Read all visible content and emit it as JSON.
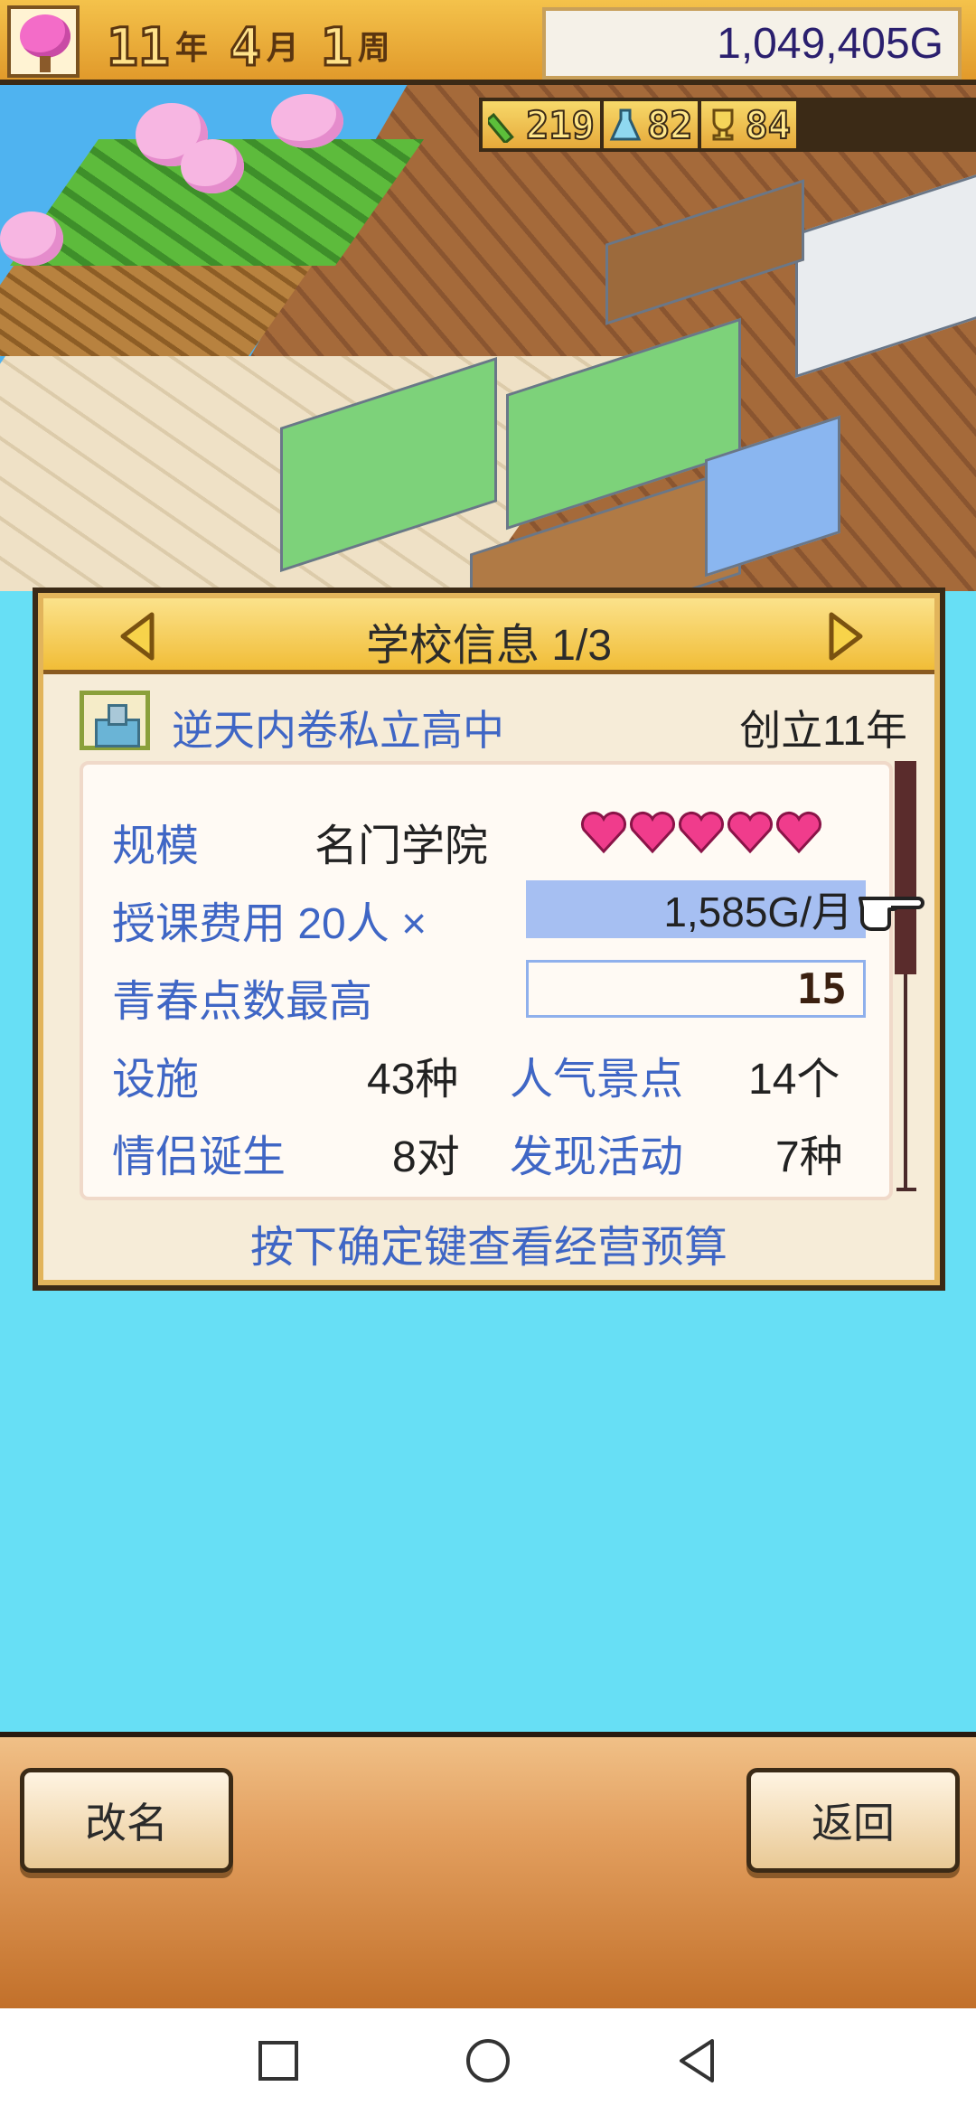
{
  "top": {
    "year": "11",
    "year_unit": "年",
    "month": "4",
    "month_unit": "月",
    "week": "1",
    "week_unit": "周",
    "money": "1,049,405G"
  },
  "stats": [
    {
      "icon": "pencil-icon",
      "value": "219"
    },
    {
      "icon": "flask-icon",
      "value": "82"
    },
    {
      "icon": "trophy-icon",
      "value": "84"
    }
  ],
  "panel": {
    "title": "学校信息 1/3",
    "school_name": "逆天内卷私立高中",
    "founded": "创立11年",
    "scale_label": "规模",
    "scale_value": "名门学院",
    "hearts": 5,
    "fee_label": "授课费用 20人 ×",
    "fee_value": "1,585G/月",
    "youth_label": "青春点数最高",
    "youth_value": "15",
    "facilities_label": "设施",
    "facilities_value": "43种",
    "spots_label": "人气景点",
    "spots_value": "14个",
    "couples_label": "情侣诞生",
    "couples_value": "8对",
    "activities_label": "发现活动",
    "activities_value": "7种",
    "hint": "按下确定键查看经营预算"
  },
  "buttons": {
    "rename": "改名",
    "back": "返回"
  },
  "colors": {
    "accent_blue": "#3f66c5",
    "heart_pink": "#f03c8c",
    "sky": "#67dff5"
  }
}
